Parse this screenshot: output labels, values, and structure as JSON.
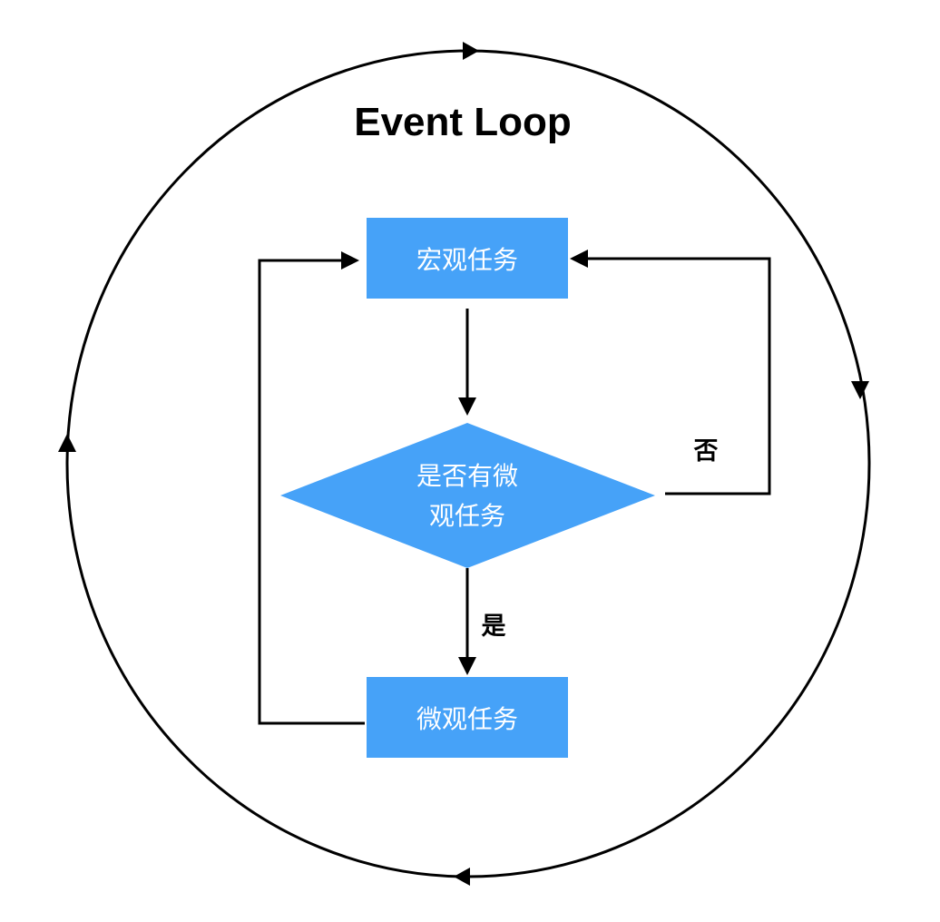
{
  "title": "Event Loop",
  "colors": {
    "node_fill": "#46a2f8",
    "node_text": "#ffffff",
    "line": "#000000",
    "background": "#ffffff"
  },
  "nodes": {
    "macro_task": "宏观任务",
    "decision_line1": "是否有微",
    "decision_line2": "观任务",
    "micro_task": "微观任务"
  },
  "edges": {
    "yes_label": "是",
    "no_label": "否"
  }
}
